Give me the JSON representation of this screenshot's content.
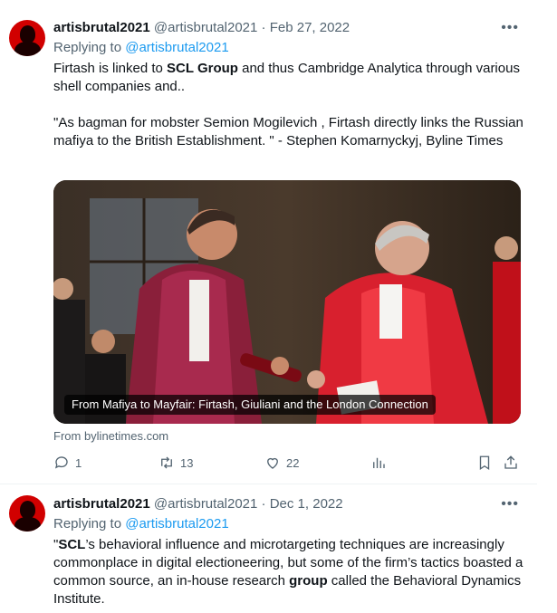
{
  "tweets": [
    {
      "author": "artisbrutal2021",
      "handle": "@artisbrutal2021",
      "date": "· Feb 27, 2022",
      "replying_prefix": "Replying to",
      "replying_to": "@artisbrutal2021",
      "more_icon": "more-dots-icon",
      "text": {
        "p1_a": "Firtash is linked to ",
        "p1_b": "SCL Group",
        "p1_c": " and thus Cambridge Analytica through various shell companies and..",
        "p2": "\"As bagman for mobster Semion Mogilevich , Firtash directly links the Russian mafiya to the British Establishment. \" - Stephen Komarnyckyj, Byline Times"
      },
      "media_caption": "From Mafiya to Mayfair: Firtash, Giuliani and the London Connection",
      "source": "From bylinetimes.com",
      "actions": {
        "replies": "1",
        "retweets": "13",
        "likes": "22"
      }
    },
    {
      "author": "artisbrutal2021",
      "handle": "@artisbrutal2021",
      "date": "· Dec 1, 2022",
      "replying_prefix": "Replying to",
      "replying_to": "@artisbrutal2021",
      "text": {
        "a": "\"",
        "b": "SCL",
        "c": "’s behavioral influence and microtargeting techniques are increasingly commonplace in digital electioneering, but some of the firm’s tactics boasted a common source, an in-house research ",
        "d": "group",
        "e": " called the Behavioral Dynamics Institute."
      }
    }
  ],
  "colors": {
    "link": "#1d9bf0",
    "secondary_text": "#536471",
    "avatar_red": "#d10000"
  }
}
